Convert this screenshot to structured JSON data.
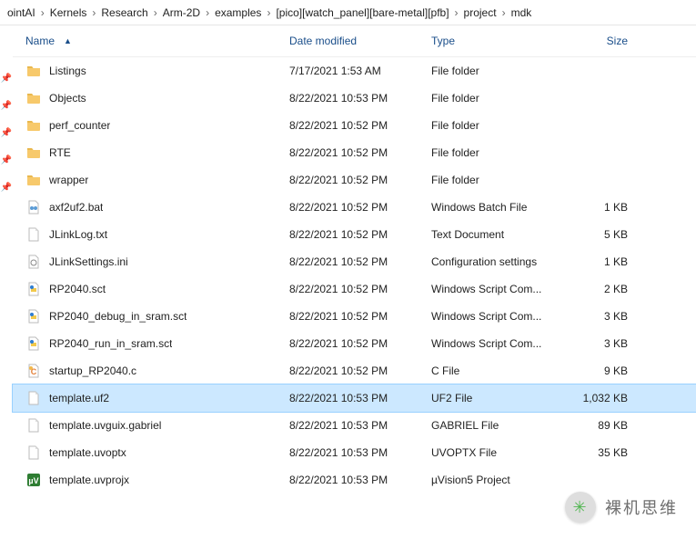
{
  "breadcrumb": [
    "ointAI",
    "Kernels",
    "Research",
    "Arm-2D",
    "examples",
    "[pico][watch_panel][bare-metal][pfb]",
    "project",
    "mdk"
  ],
  "columns": {
    "name": "Name",
    "date": "Date modified",
    "type": "Type",
    "size": "Size"
  },
  "items": [
    {
      "icon": "folder",
      "name": "Listings",
      "date": "7/17/2021 1:53 AM",
      "type": "File folder",
      "size": "",
      "pinned": true
    },
    {
      "icon": "folder",
      "name": "Objects",
      "date": "8/22/2021 10:53 PM",
      "type": "File folder",
      "size": "",
      "pinned": true
    },
    {
      "icon": "folder",
      "name": "perf_counter",
      "date": "8/22/2021 10:52 PM",
      "type": "File folder",
      "size": "",
      "pinned": true
    },
    {
      "icon": "folder",
      "name": "RTE",
      "date": "8/22/2021 10:52 PM",
      "type": "File folder",
      "size": "",
      "pinned": true
    },
    {
      "icon": "folder",
      "name": "wrapper",
      "date": "8/22/2021 10:52 PM",
      "type": "File folder",
      "size": "",
      "pinned": true
    },
    {
      "icon": "bat",
      "name": "axf2uf2.bat",
      "date": "8/22/2021 10:52 PM",
      "type": "Windows Batch File",
      "size": "1 KB"
    },
    {
      "icon": "txt",
      "name": "JLinkLog.txt",
      "date": "8/22/2021 10:52 PM",
      "type": "Text Document",
      "size": "5 KB"
    },
    {
      "icon": "ini",
      "name": "JLinkSettings.ini",
      "date": "8/22/2021 10:52 PM",
      "type": "Configuration settings",
      "size": "1 KB"
    },
    {
      "icon": "sct",
      "name": "RP2040.sct",
      "date": "8/22/2021 10:52 PM",
      "type": "Windows Script Com...",
      "size": "2 KB"
    },
    {
      "icon": "sct",
      "name": "RP2040_debug_in_sram.sct",
      "date": "8/22/2021 10:52 PM",
      "type": "Windows Script Com...",
      "size": "3 KB"
    },
    {
      "icon": "sct",
      "name": "RP2040_run_in_sram.sct",
      "date": "8/22/2021 10:52 PM",
      "type": "Windows Script Com...",
      "size": "3 KB"
    },
    {
      "icon": "cfile",
      "name": "startup_RP2040.c",
      "date": "8/22/2021 10:52 PM",
      "type": "C File",
      "size": "9 KB"
    },
    {
      "icon": "generic",
      "name": "template.uf2",
      "date": "8/22/2021 10:53 PM",
      "type": "UF2 File",
      "size": "1,032 KB",
      "selected": true
    },
    {
      "icon": "generic",
      "name": "template.uvguix.gabriel",
      "date": "8/22/2021 10:53 PM",
      "type": "GABRIEL File",
      "size": "89 KB"
    },
    {
      "icon": "generic",
      "name": "template.uvoptx",
      "date": "8/22/2021 10:53 PM",
      "type": "UVOPTX File",
      "size": "35 KB"
    },
    {
      "icon": "uvprojx",
      "name": "template.uvprojx",
      "date": "8/22/2021 10:53 PM",
      "type": "µVision5 Project",
      "size": ""
    }
  ],
  "watermark": "裸机思维"
}
